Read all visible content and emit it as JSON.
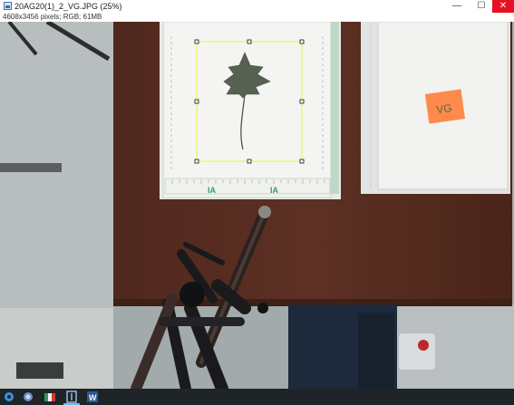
{
  "window": {
    "title": "20AG20(1)_2_VG.JPG (25%)",
    "image_info": "4608x3456 pixels; RGB; 61MB",
    "controls": {
      "minimize": "—",
      "maximize": "☐",
      "close": "✕"
    }
  },
  "photo": {
    "sticky_note_text": "VG",
    "ruler_label": "IA",
    "colors": {
      "table": "#5a2e22",
      "paper": "#f2f3f0",
      "sticky": "#ff8a4c",
      "selection": "#f2ef3a",
      "leaf": "#566151"
    }
  },
  "taskbar": {
    "items": [
      "windows-start",
      "search",
      "file-explorer",
      "image-viewer",
      "word"
    ]
  }
}
